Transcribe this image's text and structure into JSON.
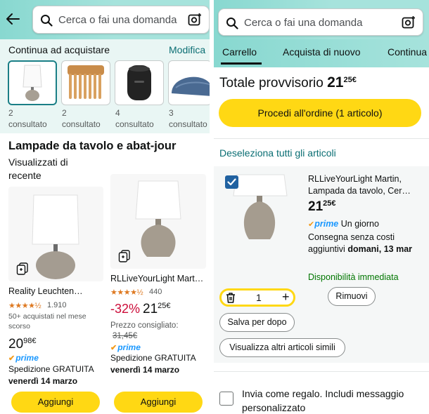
{
  "left": {
    "search": {
      "placeholder": "Cerca o fai una domanda"
    },
    "continue": {
      "title": "Continua ad acquistare",
      "link": "Modifica",
      "thumbs": [
        {
          "count": "2",
          "label": "consultato",
          "icon": "table-lamp"
        },
        {
          "count": "2",
          "label": "consultato",
          "icon": "wooden-comb"
        },
        {
          "count": "4",
          "label": "consultato",
          "icon": "bluetooth-speaker"
        },
        {
          "count": "3",
          "label": "consultato",
          "icon": "denim-cap"
        }
      ]
    },
    "section": {
      "title": "Lampade da tavolo e abat-jour",
      "subtitle": "Visualizzati di recente"
    },
    "products": [
      {
        "title": "Reality Leuchten…",
        "stars": "★★★★½",
        "rating_count": "1.910",
        "bought": "50+ acquistati nel mese scorso",
        "price_whole": "20",
        "price_fraction": "98",
        "currency": "€",
        "prime": "prime",
        "shipping": "Spedizione GRATUITA",
        "delivery": "venerdì 14 marzo",
        "add_label": "Aggiungi"
      },
      {
        "title": "RLLiveYourLight Mart…",
        "stars": "★★★★½",
        "rating_count": "440",
        "discount": "-32%",
        "price_whole": "21",
        "price_fraction": "25",
        "currency": "€",
        "list_label": "Prezzo consigliato:",
        "list_price": "31,45€",
        "prime": "prime",
        "shipping": "Spedizione GRATUITA",
        "delivery": "venerdì 14 marzo",
        "add_label": "Aggiungi"
      }
    ]
  },
  "right": {
    "search": {
      "placeholder": "Cerca o fai una domanda"
    },
    "tabs": [
      "Carrello",
      "Acquista di nuovo",
      "Continua"
    ],
    "subtotal": {
      "label": "Totale provvisorio",
      "whole": "21",
      "fraction": "25",
      "currency": "€"
    },
    "proceed_label": "Procedi all'ordine (1 articolo)",
    "deselect_label": "Deseleziona tutti gli articoli",
    "item": {
      "checked": true,
      "title": "RLLiveYourLight Martin, Lampada da tavolo, Cer…",
      "price_whole": "21",
      "price_fraction": "25",
      "currency": "€",
      "prime": "prime",
      "prime_text": "Un giorno",
      "delivery_pre": "Consegna senza costi aggiuntivi",
      "delivery_date": "domani, 13 mar",
      "stock": "Disponibilità immediata",
      "quantity": "1",
      "remove_label": "Rimuovi",
      "save_label": "Salva per dopo",
      "similar_label": "Visualizza altri articoli simili"
    },
    "gift_label": "Invia come regalo. Includi messaggio personalizzato"
  },
  "colors": {
    "header": "#88d8d0",
    "link": "#0a6e73",
    "yellow_button": "#ffd814",
    "prime_blue": "#1a98ff",
    "discount_red": "#cc0c39",
    "stock_green": "#007600",
    "star_orange": "#de7921"
  }
}
